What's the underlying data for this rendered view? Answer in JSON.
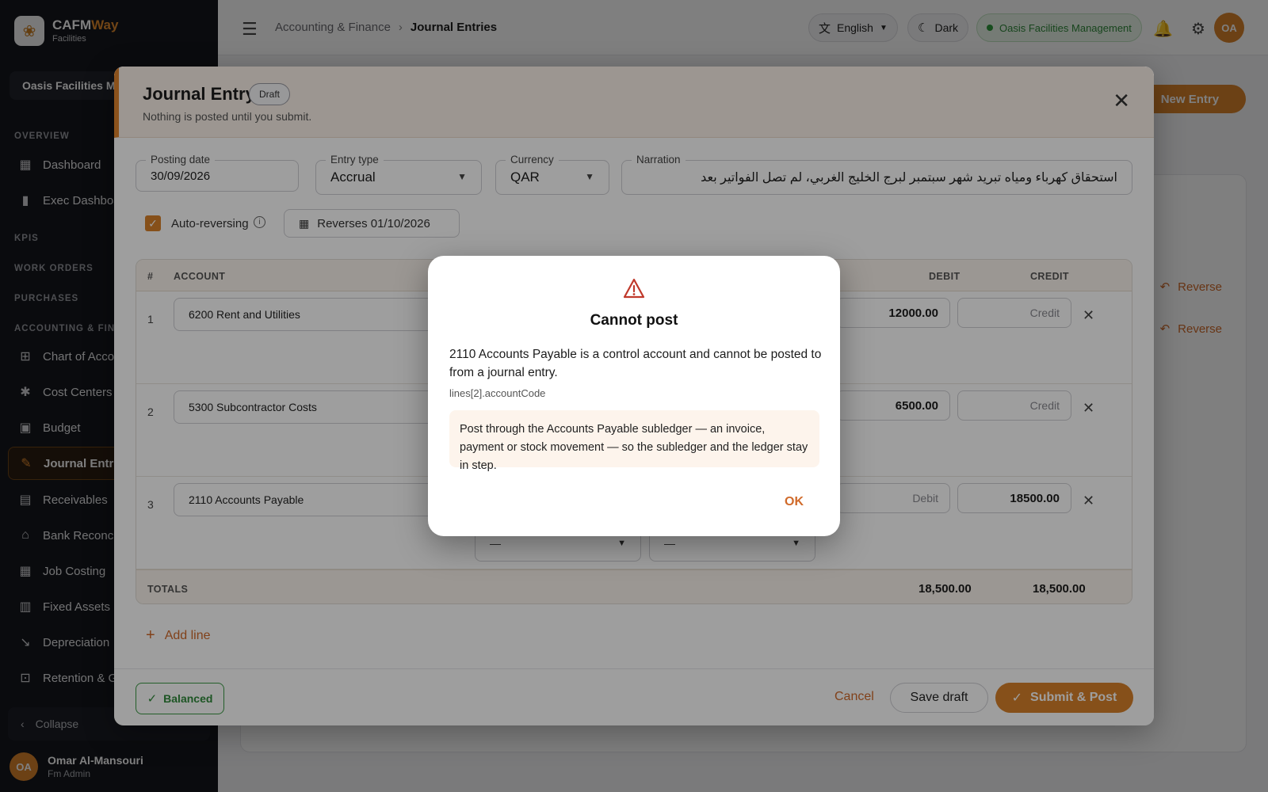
{
  "brand": {
    "name_main": "CAFM",
    "name_accent": "Way",
    "subtitle": "Facilities"
  },
  "sidebar": {
    "org": "Oasis Facilities Management",
    "sections": {
      "overview": "OVERVIEW",
      "kpis": "KPIS",
      "work_orders": "WORK ORDERS",
      "purchases": "PURCHASES",
      "accounting": "ACCOUNTING & FINANCE"
    },
    "items": {
      "dashboard": "Dashboard",
      "exec_dashboard": "Exec Dashboard",
      "chart_of_accounts": "Chart of Accounts",
      "cost_centers": "Cost Centers",
      "budget": "Budget",
      "journal_entries": "Journal Entries",
      "receivables": "Receivables",
      "bank_reconciliation": "Bank Reconciliation",
      "job_costing": "Job Costing",
      "fixed_assets": "Fixed Assets",
      "depreciation": "Depreciation",
      "retention": "Retention & Guarantees"
    },
    "collapse": "Collapse",
    "user": {
      "initials": "OA",
      "name": "Omar Al-Mansouri",
      "role": "Fm Admin"
    }
  },
  "topbar": {
    "breadcrumb": [
      "Accounting & Finance",
      "Journal Entries"
    ],
    "language": "English",
    "theme": "Dark",
    "org_chip": "Oasis Facilities Management",
    "avatar": "OA"
  },
  "page": {
    "new_entry": "New Entry",
    "reverse_label": "Reverse"
  },
  "journal_entry": {
    "title": "Journal Entry",
    "status": "Draft",
    "subtitle": "Nothing is posted until you submit.",
    "fields": {
      "posting_date": {
        "label": "Posting date",
        "value": "30/09/2026"
      },
      "entry_type": {
        "label": "Entry type",
        "value": "Accrual"
      },
      "currency": {
        "label": "Currency",
        "value": "QAR"
      },
      "narration": {
        "label": "Narration",
        "value": "استحقاق كهرباء ومياه تبريد شهر سبتمبر لبرج الخليج الغربي، لم تصل الفواتير بعد"
      }
    },
    "auto_reversing": {
      "label": "Auto-reversing",
      "checked": true
    },
    "reverses": "Reverses 01/10/2026",
    "columns": {
      "num": "#",
      "account": "ACCOUNT",
      "debit": "DEBIT",
      "credit": "CREDIT"
    },
    "lines": [
      {
        "num": "1",
        "account": "6200  Rent and Utilities",
        "debit": "12000.00",
        "credit": "Credit"
      },
      {
        "num": "2",
        "account": "5300  Subcontractor Costs",
        "debit": "6500.00",
        "credit": "Credit"
      },
      {
        "num": "3",
        "account": "2110  Accounts Payable",
        "debit": "Debit",
        "credit": "18500.00",
        "dim1": "—",
        "dim2": "—"
      }
    ],
    "totals": {
      "label": "TOTALS",
      "debit": "18,500.00",
      "credit": "18,500.00"
    },
    "add_line": "Add line",
    "balanced": "Balanced",
    "cancel": "Cancel",
    "save_draft": "Save draft",
    "submit": "Submit & Post"
  },
  "error_dialog": {
    "title": "Cannot post",
    "message": "2110 Accounts Payable is a control account and cannot be posted to from a journal entry.",
    "code": "lines[2].accountCode",
    "hint": "Post through the Accounts Payable subledger — an invoice, payment or stock movement — so the subledger and the ledger stay in step.",
    "ok": "OK"
  },
  "colors": {
    "accent": "#d9822b",
    "success": "#2f8a3a",
    "error": "#c0392b",
    "sidebar_bg": "#14161c"
  }
}
